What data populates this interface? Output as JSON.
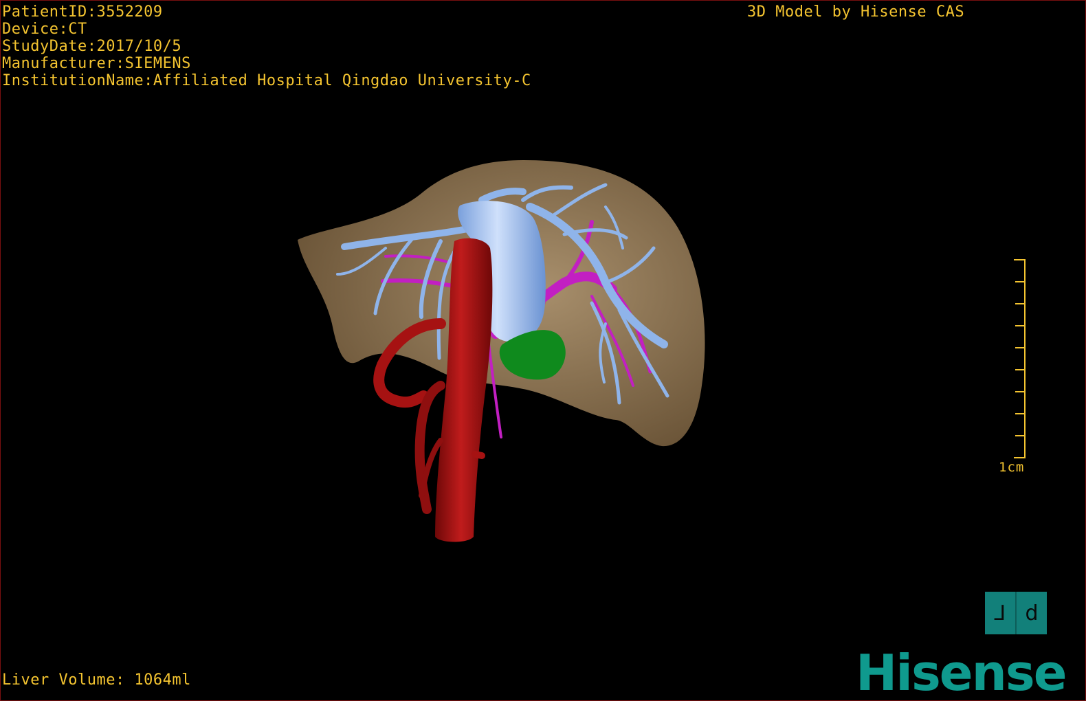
{
  "overlay": {
    "patient_id": "PatientID:3552209",
    "device": "Device:CT",
    "study_date": "StudyDate:2017/10/5",
    "manufacturer": "Manufacturer:SIEMENS",
    "institution": "InstitutionName:Affiliated Hospital Qingdao University-C",
    "credit": "3D Model by Hisense CAS",
    "liver_volume": "Liver Volume: 1064ml"
  },
  "scale_bar": {
    "label": "1cm",
    "color": "#f4c430"
  },
  "orientation_marker": {
    "left_glyph": "⅃",
    "right_glyph": "d"
  },
  "branding": {
    "logo_text": "Hisense",
    "logo_color": "#0f9a8e"
  },
  "model_colors": {
    "liver": "#8a6f47",
    "hepatic_veins": "#8fb4ea",
    "portal_vein": "#c21fc2",
    "aorta": "#a61212",
    "gallbladder": "#0f8a1d"
  }
}
